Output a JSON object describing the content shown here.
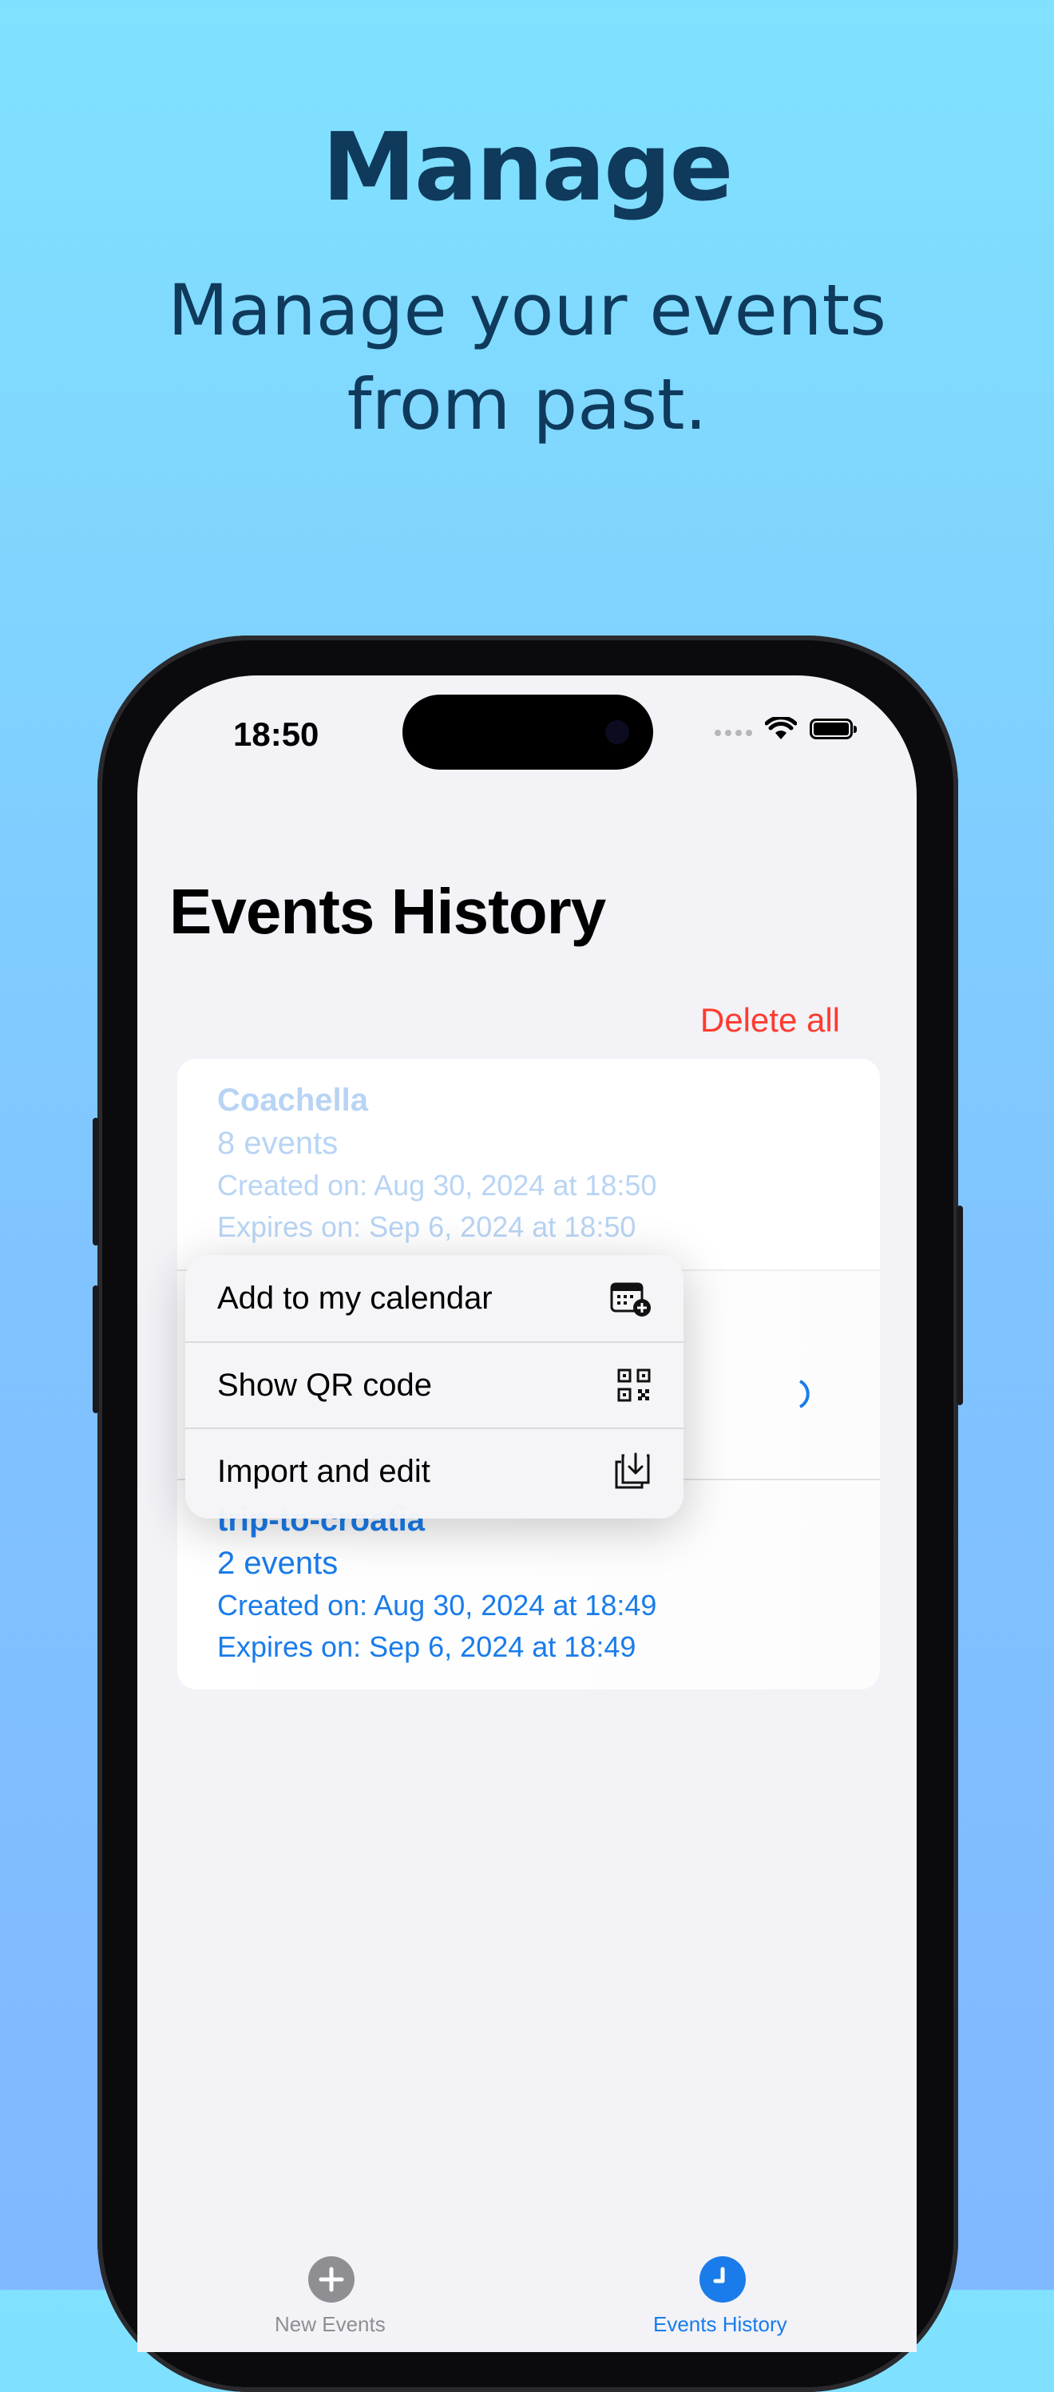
{
  "marketing": {
    "headline": "Manage",
    "subline_1": "Manage your events",
    "subline_2": "from past."
  },
  "status_bar": {
    "time": "18:50"
  },
  "screen": {
    "title": "Events History",
    "delete_all": "Delete all",
    "events": [
      {
        "name": "Coachella",
        "count": "8 events",
        "created": "Created on: Aug 30, 2024 at 18:50",
        "expires": "Expires on: Sep 6, 2024 at 18:50"
      },
      {
        "name": "trip-to-croatia",
        "count": "2 events",
        "created": "Created on: Aug 30, 2024 at 18:49",
        "expires": "Expires on: Sep 6, 2024 at 18:49"
      }
    ],
    "context_menu": [
      {
        "label": "Add to my calendar",
        "icon": "calendar-add-icon"
      },
      {
        "label": "Show QR code",
        "icon": "qr-code-icon"
      },
      {
        "label": "Import and edit",
        "icon": "import-icon"
      }
    ]
  },
  "tab_bar": {
    "tabs": [
      {
        "label": "New Events",
        "icon": "plus-circle-icon",
        "active": false
      },
      {
        "label": "Events History",
        "icon": "clock-icon",
        "active": true
      }
    ]
  },
  "colors": {
    "accent": "#1a7cea",
    "destructive": "#ff3b30",
    "headline": "#0f3a5c",
    "background_top": "#80e2ff",
    "background_bottom": "#80b8ff"
  }
}
